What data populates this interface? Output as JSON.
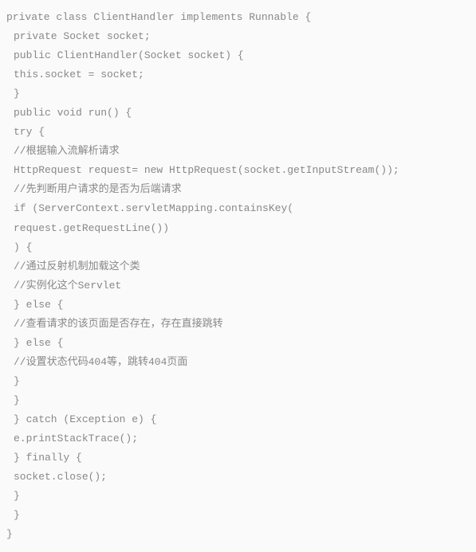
{
  "code": {
    "lines": [
      {
        "indent": 0,
        "text": "private class ClientHandler implements Runnable {"
      },
      {
        "indent": 1,
        "text": "private Socket socket;"
      },
      {
        "indent": 1,
        "text": "public ClientHandler(Socket socket) {"
      },
      {
        "indent": 1,
        "text": "this.socket = socket;"
      },
      {
        "indent": 1,
        "text": "}"
      },
      {
        "indent": 1,
        "text": "public void run() {"
      },
      {
        "indent": 1,
        "text": "try {"
      },
      {
        "indent": 1,
        "text": "//根据输入流解析请求"
      },
      {
        "indent": 1,
        "text": "HttpRequest request= new HttpRequest(socket.getInputStream());"
      },
      {
        "indent": 1,
        "text": "//先判断用户请求的是否为后端请求"
      },
      {
        "indent": 1,
        "text": "if (ServerContext.servletMapping.containsKey("
      },
      {
        "indent": 1,
        "text": "request.getRequestLine())"
      },
      {
        "indent": 1,
        "text": ") {"
      },
      {
        "indent": 1,
        "text": "//通过反射机制加载这个类"
      },
      {
        "indent": 1,
        "text": "//实例化这个Servlet"
      },
      {
        "indent": 1,
        "text": "} else {"
      },
      {
        "indent": 1,
        "text": "//查看请求的该页面是否存在，存在直接跳转"
      },
      {
        "indent": 1,
        "text": "} else {"
      },
      {
        "indent": 1,
        "text": "//设置状态代码404等，跳转404页面"
      },
      {
        "indent": 1,
        "text": "}"
      },
      {
        "indent": 1,
        "text": "}"
      },
      {
        "indent": 1,
        "text": "} catch (Exception e) {"
      },
      {
        "indent": 1,
        "text": "e.printStackTrace();"
      },
      {
        "indent": 1,
        "text": "} finally {"
      },
      {
        "indent": 1,
        "text": "socket.close();"
      },
      {
        "indent": 1,
        "text": "}"
      },
      {
        "indent": 1,
        "text": "}"
      },
      {
        "indent": 0,
        "text": "}"
      }
    ]
  }
}
